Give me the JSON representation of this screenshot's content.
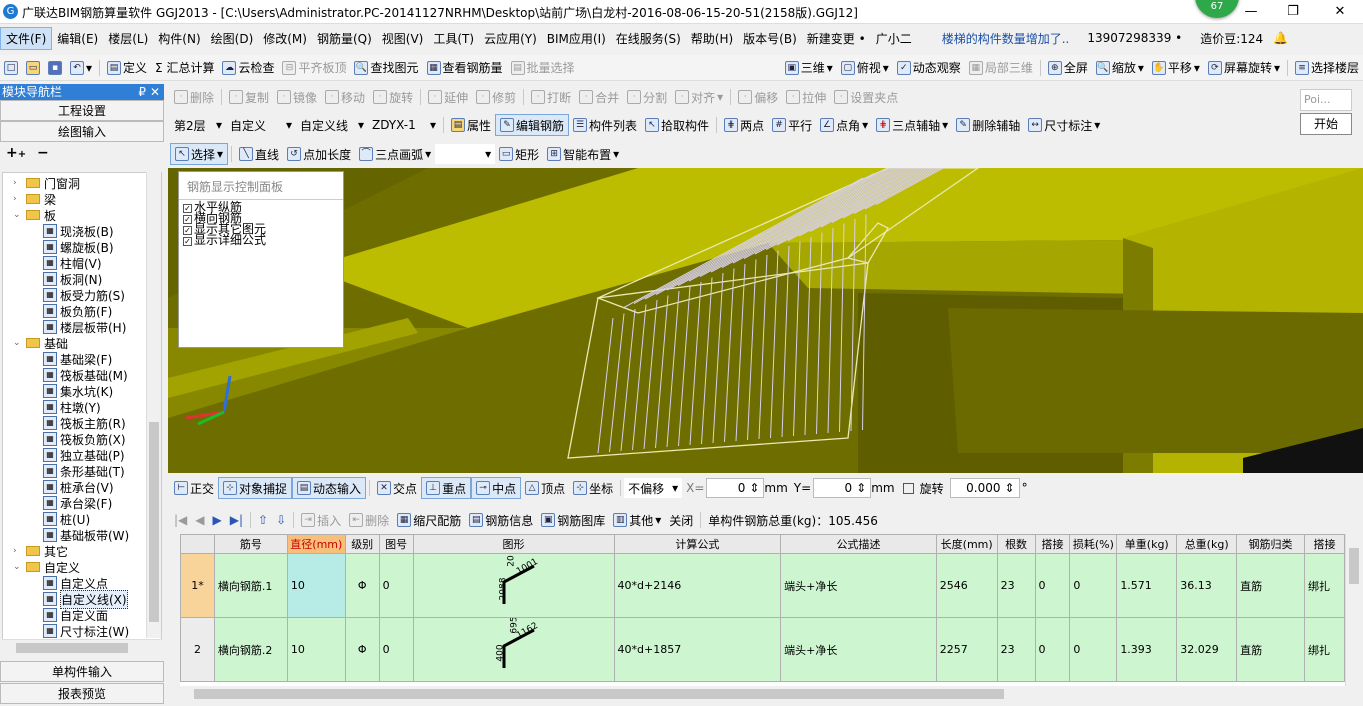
{
  "title": "广联达BIM钢筋算量软件 GGJ2013 - [C:\\Users\\Administrator.PC-20141127NRHM\\Desktop\\站前广场\\白龙村-2016-08-06-15-20-51(2158版).GGJ12]",
  "badge": "67",
  "window_controls": {
    "min": "—",
    "restore": "❐",
    "close": "✕"
  },
  "menu": [
    "文件(F)",
    "编辑(E)",
    "楼层(L)",
    "构件(N)",
    "绘图(D)",
    "修改(M)",
    "钢筋量(Q)",
    "视图(V)",
    "工具(T)",
    "云应用(Y)",
    "BIM应用(I)",
    "在线服务(S)",
    "帮助(H)",
    "版本号(B)",
    "新建变更 •",
    "广小二"
  ],
  "menu_notice": "楼梯的构件数量增加了..",
  "menu_phone": "13907298339 •",
  "menu_price": "造价豆:124",
  "toolbar1": {
    "items": [
      "定义",
      "Σ 汇总计算",
      "云检查",
      "平齐板顶",
      "查找图元",
      "查看钢筋量",
      "批量选择"
    ],
    "view3d": "三维",
    "view_top": "俯视",
    "dynamic": "动态观察",
    "partial3d": "局部三维",
    "fullscreen": "全屏",
    "zoom": "缩放",
    "pan": "平移",
    "rotate": "屏幕旋转",
    "select_floor": "选择楼层"
  },
  "toolbar2": {
    "items": [
      "删除",
      "复制",
      "镜像",
      "移动",
      "旋转",
      "延伸",
      "修剪",
      "打断",
      "合并",
      "分割",
      "对齐",
      "偏移",
      "拉伸",
      "设置夹点"
    ]
  },
  "toolbar3": {
    "floor": "第2层",
    "custom": "自定义",
    "custom_line": "自定义线",
    "zdyx": "ZDYX-1",
    "attr": "属性",
    "edit_rebar": "编辑钢筋",
    "comp_list": "构件列表",
    "pick": "拾取构件",
    "two_points": "两点",
    "parallel": "平行",
    "point_angle": "点角",
    "three_pt_aux": "三点辅轴",
    "del_aux": "删除辅轴",
    "dim": "尺寸标注"
  },
  "toolbar4": {
    "select": "选择",
    "line": "直线",
    "point_len": "点加长度",
    "arc": "三点画弧",
    "rect": "矩形",
    "smart": "智能布置"
  },
  "mini": {
    "label": "Poi...",
    "start": "开始"
  },
  "nav": {
    "title": "模块导航栏",
    "pin": "₽",
    "close": "✕",
    "project_settings": "工程设置",
    "draw_input": "绘图输入",
    "single_input": "单构件输入",
    "report_preview": "报表预览",
    "tree": [
      {
        "t": "门窗洞",
        "lvl": 1,
        "type": "folder",
        "tog": "+"
      },
      {
        "t": "梁",
        "lvl": 1,
        "type": "folder",
        "tog": "+"
      },
      {
        "t": "板",
        "lvl": 1,
        "type": "folder",
        "tog": "−"
      },
      {
        "t": "现浇板(B)",
        "lvl": 2,
        "type": "item"
      },
      {
        "t": "螺旋板(B)",
        "lvl": 2,
        "type": "item"
      },
      {
        "t": "柱帽(V)",
        "lvl": 2,
        "type": "item"
      },
      {
        "t": "板洞(N)",
        "lvl": 2,
        "type": "item"
      },
      {
        "t": "板受力筋(S)",
        "lvl": 2,
        "type": "item"
      },
      {
        "t": "板负筋(F)",
        "lvl": 2,
        "type": "item"
      },
      {
        "t": "楼层板带(H)",
        "lvl": 2,
        "type": "item"
      },
      {
        "t": "基础",
        "lvl": 1,
        "type": "folder",
        "tog": "−"
      },
      {
        "t": "基础梁(F)",
        "lvl": 2,
        "type": "item"
      },
      {
        "t": "筏板基础(M)",
        "lvl": 2,
        "type": "item"
      },
      {
        "t": "集水坑(K)",
        "lvl": 2,
        "type": "item"
      },
      {
        "t": "柱墩(Y)",
        "lvl": 2,
        "type": "item"
      },
      {
        "t": "筏板主筋(R)",
        "lvl": 2,
        "type": "item"
      },
      {
        "t": "筏板负筋(X)",
        "lvl": 2,
        "type": "item"
      },
      {
        "t": "独立基础(P)",
        "lvl": 2,
        "type": "item"
      },
      {
        "t": "条形基础(T)",
        "lvl": 2,
        "type": "item"
      },
      {
        "t": "桩承台(V)",
        "lvl": 2,
        "type": "item"
      },
      {
        "t": "承台梁(F)",
        "lvl": 2,
        "type": "item"
      },
      {
        "t": "桩(U)",
        "lvl": 2,
        "type": "item"
      },
      {
        "t": "基础板带(W)",
        "lvl": 2,
        "type": "item"
      },
      {
        "t": "其它",
        "lvl": 1,
        "type": "folder",
        "tog": "+"
      },
      {
        "t": "自定义",
        "lvl": 1,
        "type": "folder",
        "tog": "−"
      },
      {
        "t": "自定义点",
        "lvl": 2,
        "type": "item"
      },
      {
        "t": "自定义线(X)",
        "lvl": 2,
        "type": "item",
        "selected": true
      },
      {
        "t": "自定义面",
        "lvl": 2,
        "type": "item"
      },
      {
        "t": "尺寸标注(W)",
        "lvl": 2,
        "type": "item"
      }
    ]
  },
  "control_panel": {
    "title": "钢筋显示控制面板",
    "items": [
      "水平纵筋",
      "横向钢筋",
      "显示其它图元",
      "显示详细公式"
    ]
  },
  "snapbar": {
    "ortho": "正交",
    "obj_snap": "对象捕捉",
    "dyn_input": "动态输入",
    "intersect": "交点",
    "perp": "重点",
    "mid": "中点",
    "vertex": "顶点",
    "coord": "坐标",
    "offset": "不偏移",
    "x_label": "X=",
    "x_val": "0",
    "unit": "mm",
    "y_label": "Y=",
    "y_val": "0",
    "rotate": "旋转",
    "rot_val": "0.000",
    "deg": "°"
  },
  "gridbar": {
    "insert": "插入",
    "delete": "删除",
    "scale": "缩尺配筋",
    "rebar_info": "钢筋信息",
    "library": "钢筋图库",
    "other": "其他",
    "close": "关闭",
    "total_label": "单构件钢筋总重(kg)：105.456"
  },
  "table": {
    "headers": [
      "筋号",
      "直径(mm)",
      "级别",
      "图号",
      "图形",
      "计算公式",
      "公式描述",
      "长度(mm)",
      "根数",
      "搭接",
      "损耗(%)",
      "单重(kg)",
      "总重(kg)",
      "钢筋归类",
      "搭接"
    ],
    "rows": [
      {
        "idx": "1*",
        "name": "横向钢筋.1",
        "dia": "10",
        "grade": "Φ",
        "fig": "0",
        "s1": "2088",
        "s2": "1001",
        "s3": "20",
        "formula": "40*d+2146",
        "desc": "端头+净长",
        "len": "2546",
        "count": "23",
        "lap": "0",
        "loss": "0",
        "unit_w": "1.571",
        "total_w": "36.13",
        "cat": "直筋",
        "lap2": "绑扎"
      },
      {
        "idx": "2",
        "name": "横向钢筋.2",
        "dia": "10",
        "grade": "Φ",
        "fig": "0",
        "s1": "400",
        "s2": "1162",
        "s3": "695",
        "formula": "40*d+1857",
        "desc": "端头+净长",
        "len": "2257",
        "count": "23",
        "lap": "0",
        "loss": "0",
        "unit_w": "1.393",
        "total_w": "32.029",
        "cat": "直筋",
        "lap2": "绑扎"
      }
    ]
  },
  "colors": {
    "accent": "#2f7fd6",
    "viewport": "#646400",
    "row_green": "#cdf5d0",
    "header_hl": "#f6c07a"
  }
}
